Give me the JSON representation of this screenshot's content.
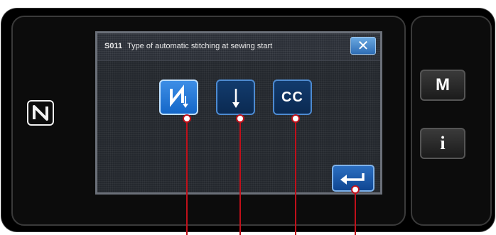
{
  "dialog": {
    "code": "S011",
    "title": "Type of automatic stitching at sewing start",
    "close_label": "✕"
  },
  "options": [
    {
      "name": "pattern-stitch-option",
      "selected": true
    },
    {
      "name": "single-stitch-option",
      "selected": false
    },
    {
      "name": "cc-option",
      "label": "CC",
      "selected": false
    }
  ],
  "side_buttons": {
    "mode_label": "M",
    "info_label": "i"
  },
  "icons": {
    "nfc": "nfc-icon",
    "close": "close-icon",
    "enter": "enter-icon"
  },
  "colors": {
    "accent": "#1467c8",
    "callout": "#c0101a"
  }
}
